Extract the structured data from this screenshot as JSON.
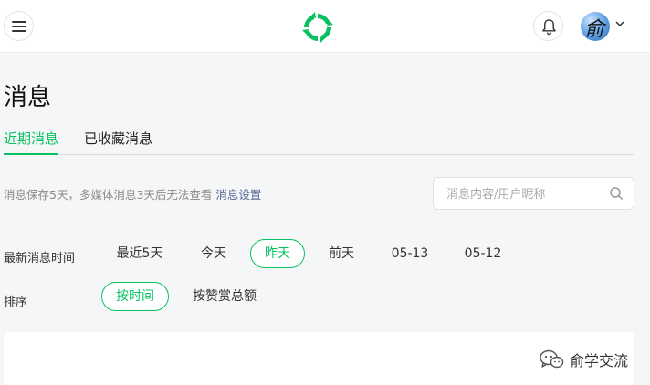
{
  "header": {
    "menu_icon": "hamburger-icon",
    "logo_icon": "recycle-logo-icon",
    "bell_icon": "bell-icon",
    "avatar_glyph": "俞",
    "caret_icon": "chevron-down-icon",
    "accent_color": "#07c160"
  },
  "page": {
    "title": "消息"
  },
  "tabs": [
    {
      "label": "近期消息",
      "active": true
    },
    {
      "label": "已收藏消息",
      "active": false
    }
  ],
  "notice": {
    "text": "消息保存5天，多媒体消息3天后无法查看",
    "link": "消息设置"
  },
  "search": {
    "placeholder": "消息内容/用户昵称",
    "value": ""
  },
  "filters": {
    "time_label": "最新消息时间",
    "time_options": [
      {
        "label": "最近5天",
        "active": false
      },
      {
        "label": "今天",
        "active": false
      },
      {
        "label": "昨天",
        "active": true
      },
      {
        "label": "前天",
        "active": false
      },
      {
        "label": "05-13",
        "active": false
      },
      {
        "label": "05-12",
        "active": false
      }
    ],
    "sort_label": "排序",
    "sort_options": [
      {
        "label": "按时间",
        "active": true
      },
      {
        "label": "按赞赏总额",
        "active": false
      }
    ]
  },
  "watermark": {
    "text": "俞学交流"
  }
}
